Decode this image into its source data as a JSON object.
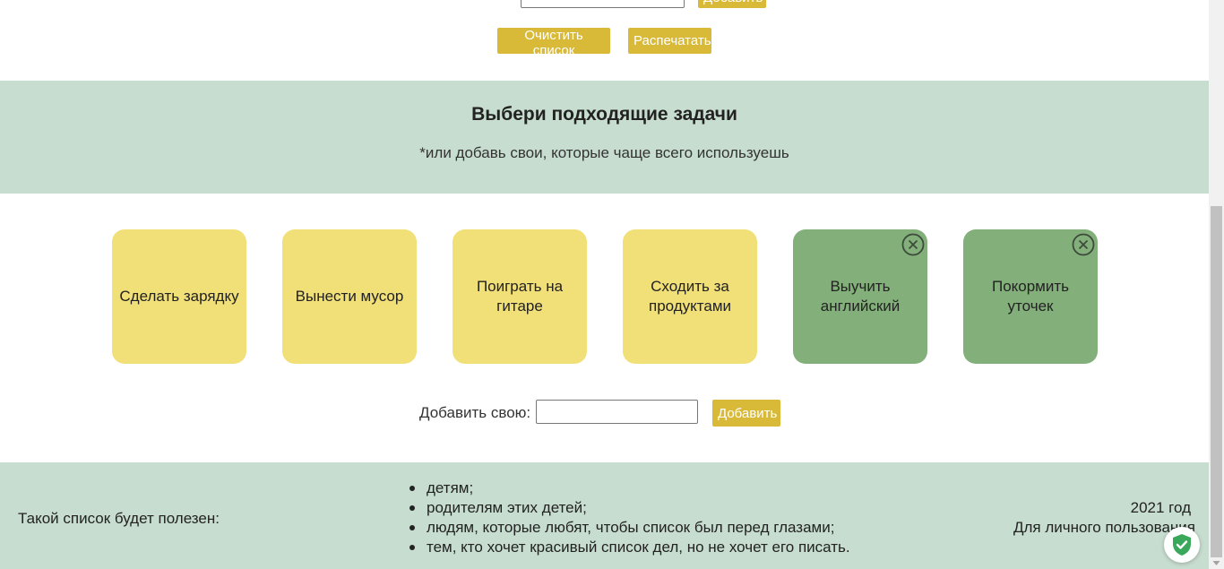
{
  "top": {
    "add_label": "Добавить",
    "clear_label": "Очистить список",
    "print_label": "Распечатать"
  },
  "hero": {
    "title": "Выбери подходящие задачи",
    "subtitle": "*или добавь свои, которые чаще всего используешь"
  },
  "tasks": [
    {
      "label": "Сделать зарядку",
      "kind": "preset"
    },
    {
      "label": "Вынести мусор",
      "kind": "preset"
    },
    {
      "label": "Поиграть на гитаре",
      "kind": "preset"
    },
    {
      "label": "Сходить за продуктами",
      "kind": "preset"
    },
    {
      "label": "Выучить английский",
      "kind": "custom"
    },
    {
      "label": "Покормить уточек",
      "kind": "custom"
    }
  ],
  "add_custom": {
    "label": "Добавить свою:",
    "value": "",
    "button_label": "Добавить"
  },
  "footer": {
    "useful_label": "Такой список будет полезен:",
    "useful_items": [
      "детям;",
      "родителям этих детей;",
      "людям, которые любят, чтобы список был перед глазами;",
      "тем, кто хочет красивый список дел, но не хочет его писать."
    ],
    "year": "2021 год",
    "usage": "Для личного пользования"
  },
  "colors": {
    "accent_button": "#d9b938",
    "preset_card": "#f1df78",
    "custom_card": "#83b07a",
    "section_bg": "#c7ddcf"
  },
  "icons": {
    "card_remove": "close-circle-icon",
    "badge": "shield-check-icon"
  }
}
